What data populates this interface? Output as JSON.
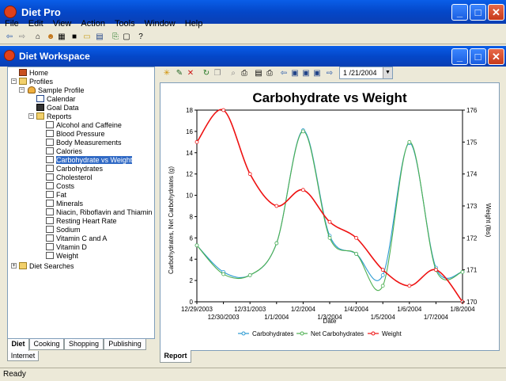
{
  "app": {
    "title": "Diet Pro"
  },
  "menu": [
    "File",
    "Edit",
    "View",
    "Action",
    "Tools",
    "Window",
    "Help"
  ],
  "workspace": {
    "title": "Diet Workspace"
  },
  "tree": [
    {
      "label": "Home",
      "icon": "home-icon"
    },
    {
      "label": "Profiles",
      "icon": "folder-icon"
    },
    {
      "label": "Sample Profile",
      "icon": "person-icon"
    },
    {
      "label": "Calendar",
      "icon": "calendar-icon"
    },
    {
      "label": "Goal Data",
      "icon": "goal-icon"
    },
    {
      "label": "Reports",
      "icon": "folder-icon"
    },
    {
      "label": "Alcohol and Caffeine",
      "icon": "doc-icon"
    },
    {
      "label": "Blood Pressure",
      "icon": "doc-icon"
    },
    {
      "label": "Body Measurements",
      "icon": "doc-icon"
    },
    {
      "label": "Calories",
      "icon": "doc-icon"
    },
    {
      "label": "Carbohydrate vs Weight",
      "icon": "doc-icon"
    },
    {
      "label": "Carbohydrates",
      "icon": "doc-icon"
    },
    {
      "label": "Cholesterol",
      "icon": "doc-icon"
    },
    {
      "label": "Costs",
      "icon": "doc-icon"
    },
    {
      "label": "Fat",
      "icon": "doc-icon"
    },
    {
      "label": "Minerals",
      "icon": "doc-icon"
    },
    {
      "label": "Niacin, Riboflavin and Thiamin",
      "icon": "doc-icon"
    },
    {
      "label": "Resting Heart Rate",
      "icon": "doc-icon"
    },
    {
      "label": "Sodium",
      "icon": "doc-icon"
    },
    {
      "label": "Vitamin C and A",
      "icon": "doc-icon"
    },
    {
      "label": "Vitamin D",
      "icon": "doc-icon"
    },
    {
      "label": "Weight",
      "icon": "doc-icon"
    },
    {
      "label": "Diet Searches",
      "icon": "folder-icon"
    }
  ],
  "left_tabs": [
    "Diet",
    "Cooking",
    "Shopping",
    "Publishing"
  ],
  "internet_tab": "Internet",
  "date_value": "1 /21/2004",
  "report_tab": "Report",
  "status": "Ready",
  "chart_data": {
    "type": "line",
    "title": "Carbohydrate vs Weight",
    "xlabel": "Date",
    "ylabel": "Carbohydrates, Net Carbohydrates (g)",
    "y2label": "Weight (lbs)",
    "x_ticks_top": [
      "12/29/2003",
      "12/31/2003",
      "1/2/2004",
      "1/4/2004",
      "1/6/2004",
      "1/8/2004"
    ],
    "x_ticks_bottom": [
      "12/30/2003",
      "1/1/2004",
      "1/3/2004",
      "1/5/2004",
      "1/7/2004"
    ],
    "ylim": [
      0,
      18
    ],
    "y_ticks": [
      0,
      2,
      4,
      6,
      8,
      10,
      12,
      14,
      16,
      18
    ],
    "y2lim": [
      170,
      176
    ],
    "y2_ticks": [
      170,
      171,
      172,
      173,
      174,
      175,
      176
    ],
    "x": [
      "12/29/2003",
      "12/30/2003",
      "12/31/2003",
      "1/1/2004",
      "1/2/2004",
      "1/3/2004",
      "1/4/2004",
      "1/5/2004",
      "1/6/2004",
      "1/7/2004",
      "1/8/2004"
    ],
    "series": [
      {
        "name": "Carbohydrates",
        "color": "#2a9ad2",
        "axis": "left",
        "values": [
          5.3,
          2.8,
          2.5,
          5.5,
          16.1,
          6.2,
          4.5,
          2.5,
          14.9,
          3.2,
          2.8
        ]
      },
      {
        "name": "Net Carbohydrates",
        "color": "#4caf50",
        "axis": "left",
        "values": [
          5.3,
          2.6,
          2.5,
          5.5,
          16.0,
          6.0,
          4.5,
          1.5,
          15.0,
          3.0,
          2.8
        ]
      },
      {
        "name": "Weight",
        "color": "#ee1111",
        "axis": "right",
        "values": [
          175.0,
          176.0,
          174.0,
          173.0,
          173.5,
          172.5,
          172.0,
          171.0,
          170.5,
          171.0,
          170.0
        ]
      }
    ],
    "legend_position": "bottom"
  }
}
